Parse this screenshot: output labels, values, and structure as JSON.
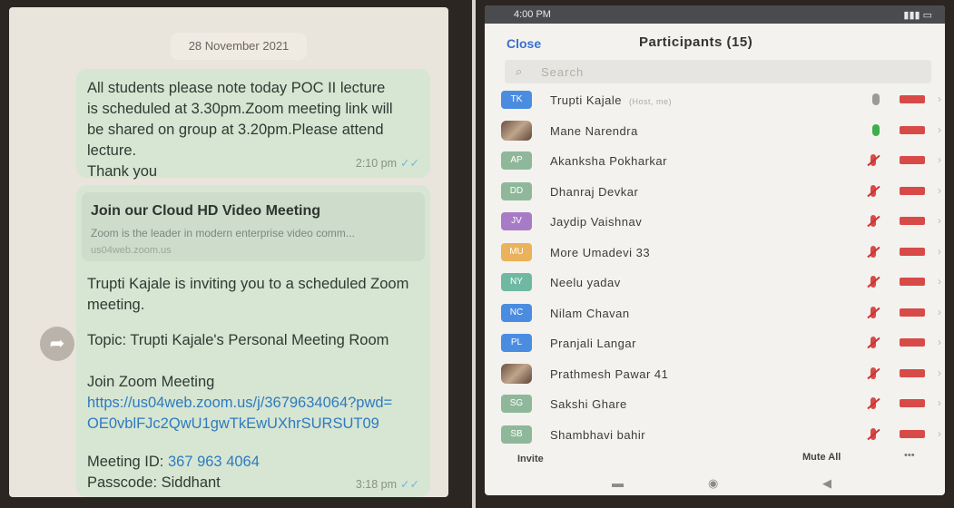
{
  "chat": {
    "date": "28 November 2021",
    "message1": {
      "text": "All students please note today POC II lecture\nis scheduled at 3.30pm.Zoom meeting link will\nbe shared on group at 3.20pm.Please attend\nlecture.\nThank you",
      "time": "2:10 pm"
    },
    "message2": {
      "preview_title": "Join our Cloud HD Video Meeting",
      "preview_desc": "Zoom is the leader in modern enterprise video comm...",
      "preview_domain": "us04web.zoom.us",
      "invite_line1": "Trupti Kajale is inviting you to a scheduled Zoom",
      "invite_line2": "meeting.",
      "topic": "Topic: Trupti Kajale's Personal Meeting Room",
      "join_label": "Join Zoom Meeting",
      "link_line1": "https://us04web.zoom.us/j/3679634064?pwd=",
      "link_line2": "OE0vblFJc2QwU1gwTkEwUXhrSURSUT09",
      "meeting_id_label": "Meeting ID: ",
      "meeting_id": "367 963 4064",
      "passcode": "Passcode: Siddhant",
      "time": "3:18 pm"
    },
    "tick_icon": "double-check-icon",
    "forward_icon": "forward-icon"
  },
  "zoom": {
    "status_time": "4:00 PM",
    "close_label": "Close",
    "title": "Participants (15)",
    "search_placeholder": "Search",
    "participants": [
      {
        "initials": "TK",
        "name": "Trupti Kajale",
        "role": "(Host, me)",
        "color": "#4a8de0",
        "mic": "neutral"
      },
      {
        "initials": "",
        "name": "Mane Narendra",
        "role": "",
        "color": "photo",
        "mic": "on"
      },
      {
        "initials": "AP",
        "name": "Akanksha Pokharkar",
        "role": "",
        "color": "#8fb89a",
        "mic": "off"
      },
      {
        "initials": "DD",
        "name": "Dhanraj Devkar",
        "role": "",
        "color": "#8fb89a",
        "mic": "off"
      },
      {
        "initials": "JV",
        "name": "Jaydip Vaishnav",
        "role": "",
        "color": "#a77bc6",
        "mic": "off"
      },
      {
        "initials": "MU",
        "name": "More Umadevi 33",
        "role": "",
        "color": "#eab25a",
        "mic": "off"
      },
      {
        "initials": "NY",
        "name": "Neelu yadav",
        "role": "",
        "color": "#6fb8a2",
        "mic": "off"
      },
      {
        "initials": "NC",
        "name": "Nilam Chavan",
        "role": "",
        "color": "#4a8de0",
        "mic": "off"
      },
      {
        "initials": "PL",
        "name": "Pranjali Langar",
        "role": "",
        "color": "#4a8de0",
        "mic": "off"
      },
      {
        "initials": "",
        "name": "Prathmesh Pawar 41",
        "role": "",
        "color": "photo",
        "mic": "off"
      },
      {
        "initials": "SG",
        "name": "Sakshi Ghare",
        "role": "",
        "color": "#8fb89a",
        "mic": "off"
      },
      {
        "initials": "SB",
        "name": "Shambhavi bahir",
        "role": "",
        "color": "#8fb89a",
        "mic": "off"
      }
    ],
    "invite_label": "Invite",
    "mute_all_label": "Mute All",
    "more_label": "•••"
  }
}
